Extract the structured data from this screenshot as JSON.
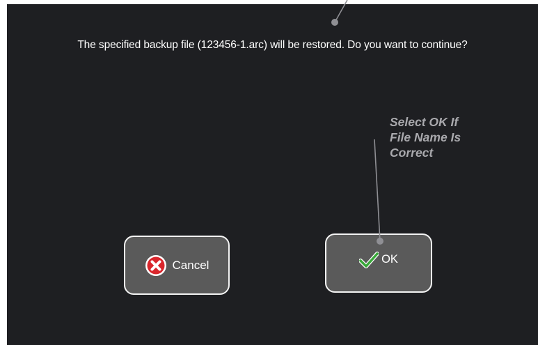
{
  "dialog": {
    "message": "The specified backup file (123456-1.arc) will be restored. Do you want to continue?"
  },
  "buttons": {
    "cancel_label": "Cancel",
    "ok_label": "OK"
  },
  "annotation": {
    "lines": [
      "Select OK If",
      "File Name Is",
      "Correct"
    ]
  },
  "colors": {
    "background": "#1e1f22",
    "button_fill": "#5a5a5a",
    "button_border": "#f4f4f4",
    "cancel_icon": "#d9262c",
    "ok_check": "#3aa83a",
    "annotation_text": "#a9a9ad"
  },
  "icons": {
    "cancel": "x-circle-icon",
    "ok": "checkmark-icon"
  }
}
